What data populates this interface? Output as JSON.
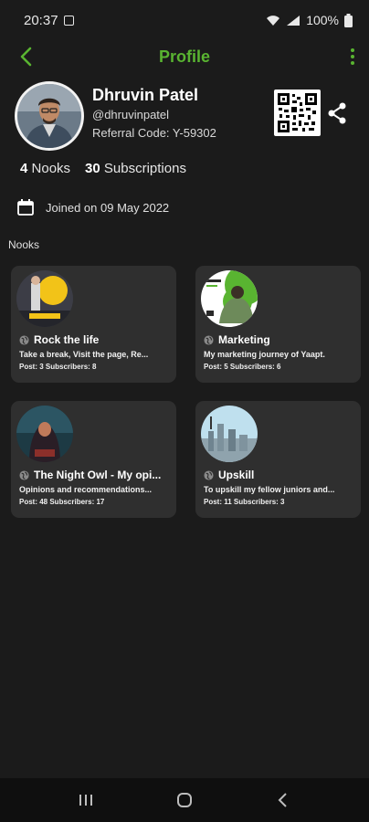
{
  "status_bar": {
    "time": "20:37",
    "battery": "100%"
  },
  "app_bar": {
    "title": "Profile"
  },
  "profile": {
    "name": "Dhruvin Patel",
    "handle": "@dhruvinpatel",
    "referral": "Referral Code: Y-59302",
    "nooks_count": "4",
    "nooks_label": "Nooks",
    "subs_count": "30",
    "subs_label": "Subscriptions",
    "joined": "Joined on 09 May 2022"
  },
  "nooks_section_label": "Nooks",
  "nooks": [
    {
      "title": "Rock the life",
      "desc": "Take a break, Visit the page, Re...",
      "stats": "Post: 3 Subscribers: 8"
    },
    {
      "title": "Marketing",
      "desc": "My marketing journey of Yaapt.",
      "stats": "Post: 5 Subscribers: 6"
    },
    {
      "title": "The Night Owl - My opi...",
      "desc": "Opinions and recommendations...",
      "stats": "Post: 48 Subscribers: 17"
    },
    {
      "title": "Upskill",
      "desc": "To upskill my fellow juniors and...",
      "stats": "Post: 11 Subscribers: 3"
    }
  ],
  "colors": {
    "accent": "#59b431",
    "background": "#1b1b1b",
    "card": "#2f2f2f"
  }
}
